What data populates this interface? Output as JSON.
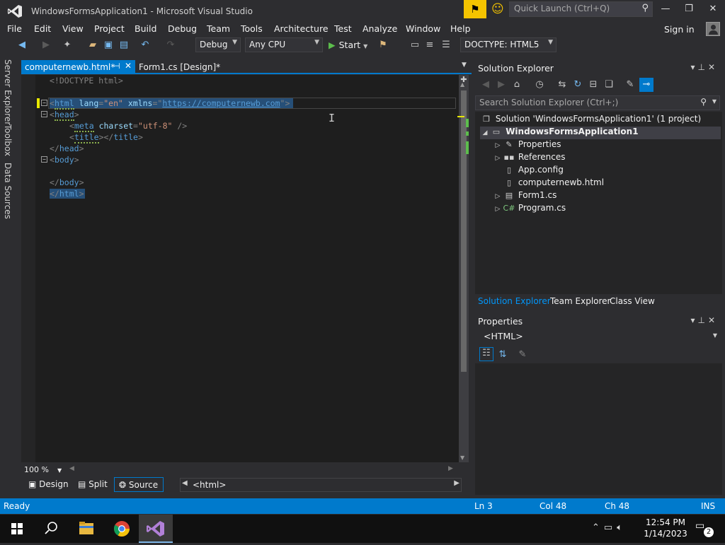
{
  "window": {
    "title": "WindowsFormsApplication1 - Microsoft Visual Studio",
    "quick_launch_placeholder": "Quick Launch (Ctrl+Q)"
  },
  "menu": {
    "items": [
      "File",
      "Edit",
      "View",
      "Project",
      "Build",
      "Debug",
      "Team",
      "Tools",
      "Architecture",
      "Test",
      "Analyze",
      "Window",
      "Help"
    ],
    "sign_in": "Sign in"
  },
  "toolbar": {
    "configuration": "Debug",
    "platform": "Any CPU",
    "start_label": "Start",
    "doctype": "DOCTYPE: HTML5"
  },
  "side_tabs": [
    "Server Explorer",
    "Toolbox",
    "Data Sources"
  ],
  "editor": {
    "tabs": [
      {
        "label": "computernewb.html*",
        "active": true
      },
      {
        "label": "Form1.cs [Design]*",
        "active": false
      }
    ],
    "zoom": "100 %",
    "views": {
      "design": "Design",
      "split": "Split",
      "source": "Source"
    },
    "breadcrumb": "<html>"
  },
  "code": {
    "l1": "<!DOCTYPE html>",
    "l2_tag": "html",
    "l2_attr1": "lang",
    "l2_val1": "\"en\"",
    "l2_attr2": "xmlns",
    "l2_url": "https://computernewb.com",
    "l3_tag": "head",
    "l4_tag": "meta",
    "l4_attr": "charset",
    "l4_val": "\"utf-8\"",
    "l5_tag": "title",
    "l5_close": "title",
    "l6_close": "head",
    "l7_tag": "body",
    "l9_close": "body",
    "l10_close": "html"
  },
  "solution_explorer": {
    "title": "Solution Explorer",
    "search_placeholder": "Search Solution Explorer (Ctrl+;)",
    "solution": "Solution 'WindowsFormsApplication1' (1 project)",
    "project": "WindowsFormsApplication1",
    "items": [
      "Properties",
      "References",
      "App.config",
      "computernewb.html",
      "Form1.cs",
      "Program.cs"
    ],
    "bottom_tabs": [
      "Solution Explorer",
      "Team Explorer",
      "Class View"
    ]
  },
  "properties": {
    "title": "Properties",
    "object": "<HTML>"
  },
  "status": {
    "text": "Ready",
    "ln": "Ln 3",
    "col": "Col 48",
    "ch": "Ch 48",
    "mode": "INS"
  },
  "taskbar": {
    "time": "12:54 PM",
    "date": "1/14/2023",
    "notifications": "2"
  },
  "colors": {
    "accent": "#007acc",
    "background": "#2d2d30",
    "editor_bg": "#1e1e1e",
    "selection": "#264f78"
  }
}
